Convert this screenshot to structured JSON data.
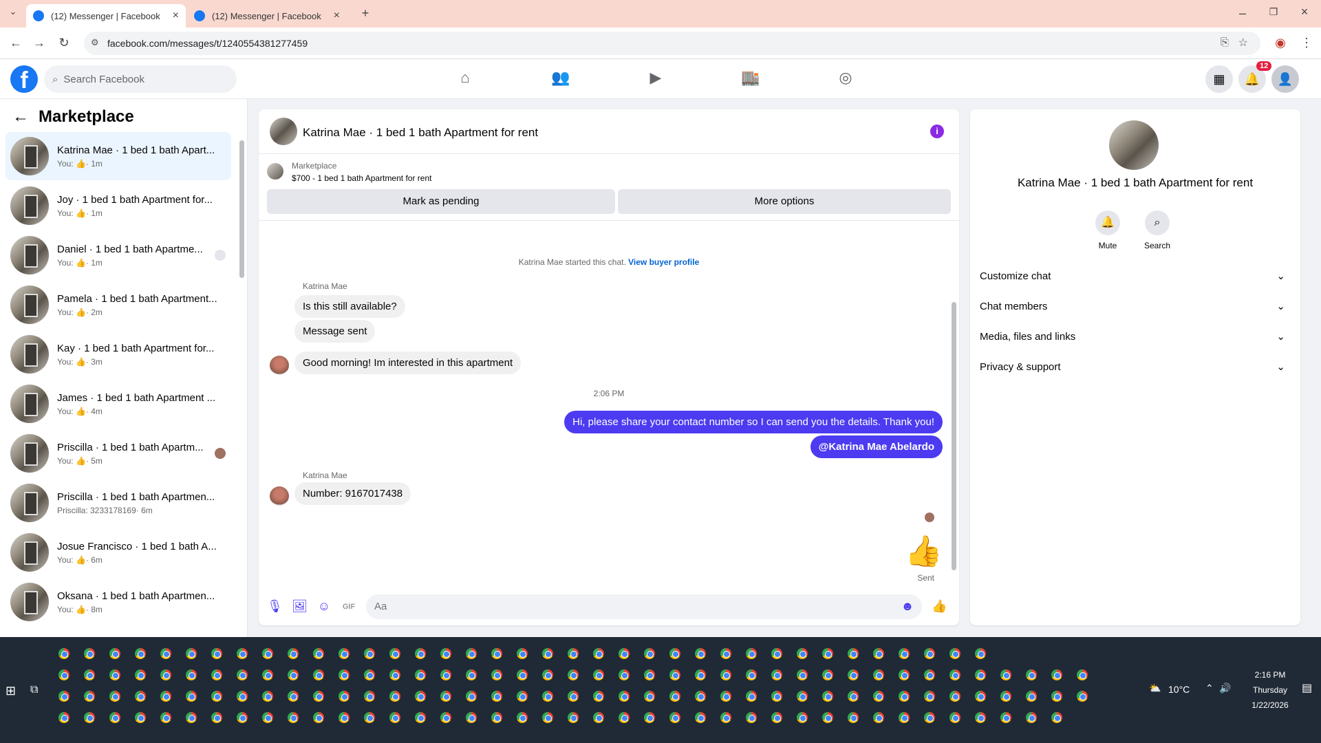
{
  "browser": {
    "tabs": [
      {
        "title": "(12) Messenger | Facebook"
      },
      {
        "title": "(12) Messenger | Facebook"
      }
    ],
    "url": "facebook.com/messages/t/1240554381277459"
  },
  "header": {
    "search_placeholder": "Search Facebook",
    "notification_count": "12"
  },
  "sidebar": {
    "title": "Marketplace",
    "conversations": [
      {
        "name": "Katrina Mae · 1 bed 1 bath Apart...",
        "prefix": "You:",
        "time": "· 1m",
        "selected": true
      },
      {
        "name": "Joy · 1 bed 1 bath Apartment for...",
        "prefix": "You:",
        "time": "· 1m"
      },
      {
        "name": "Daniel · 1 bed 1 bath Apartme...",
        "prefix": "You:",
        "time": "· 1m"
      },
      {
        "name": "Pamela · 1 bed 1 bath Apartment...",
        "prefix": "You:",
        "time": "· 2m"
      },
      {
        "name": "Kay · 1 bed 1 bath Apartment for...",
        "prefix": "You:",
        "time": "· 3m"
      },
      {
        "name": "James · 1 bed 1 bath Apartment ...",
        "prefix": "You:",
        "time": "· 4m"
      },
      {
        "name": "Priscilla · 1 bed 1 bath Apartm...",
        "prefix": "You:",
        "time": "· 5m"
      },
      {
        "name": "Priscilla · 1 bed 1 bath Apartmen...",
        "prefix": "Priscilla: 3233178169",
        "time": "· 6m"
      },
      {
        "name": "Josue Francisco · 1 bed 1 bath A...",
        "prefix": "You:",
        "time": "· 6m"
      },
      {
        "name": "Oksana · 1 bed 1 bath Apartmen...",
        "prefix": "You:",
        "time": "· 8m"
      }
    ]
  },
  "chat": {
    "title": "Katrina Mae · 1 bed 1 bath Apartment for rent",
    "marketplace_label": "Marketplace",
    "listing": "$700 - 1 bed 1 bath Apartment for rent",
    "mark_pending": "Mark as pending",
    "more_options": "More options",
    "started_text": "Katrina Mae started this chat.",
    "view_profile": "View buyer profile",
    "sender_name": "Katrina Mae",
    "messages_in_1": [
      "Is this still available?",
      "Message sent",
      "Good morning! Im interested in this apartment"
    ],
    "timestamp": "2:06 PM",
    "messages_out": [
      "Hi, please share your contact number so I can send you the details. Thank you!",
      "@Katrina Mae Abelardo"
    ],
    "messages_in_2": [
      "Number: 9167017438"
    ],
    "sent_label": "Sent",
    "compose_placeholder": "Aa"
  },
  "details": {
    "title": "Katrina Mae · 1 bed 1 bath Apartment for rent",
    "mute": "Mute",
    "search": "Search",
    "sections": [
      "Customize chat",
      "Chat members",
      "Media, files and links",
      "Privacy & support"
    ]
  },
  "taskbar": {
    "weather": "10°C",
    "time": "2:16 PM",
    "day": "Thursday",
    "date": "1/22/2026"
  },
  "colors": {
    "accent": "#4c3bf0",
    "fb_blue": "#1877f2",
    "info": "#8a2be2"
  }
}
